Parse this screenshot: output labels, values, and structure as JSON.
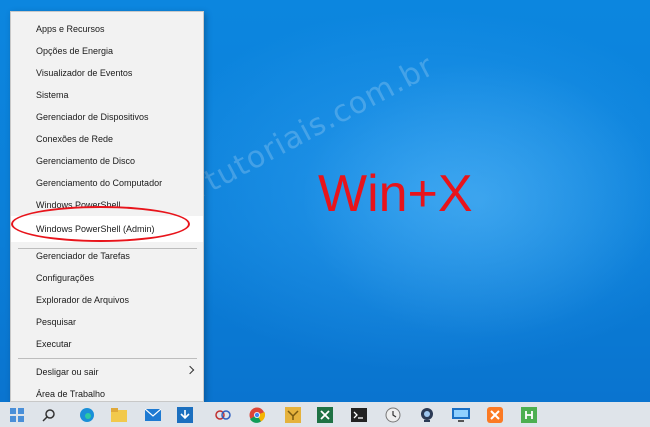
{
  "desktop": {
    "hotkey_label": "Win+X",
    "watermark_text": "supertutoriais.com.br",
    "accent_color": "#e8141b"
  },
  "menu": {
    "items": [
      "Apps e Recursos",
      "Opções de Energia",
      "Visualizador de Eventos",
      "Sistema",
      "Gerenciador de Dispositivos",
      "Conexões de Rede",
      "Gerenciamento de Disco",
      "Gerenciamento do Computador",
      "Windows PowerShell",
      "Windows PowerShell (Admin)",
      "Gerenciador de Tarefas",
      "Configurações",
      "Explorador de Arquivos",
      "Pesquisar",
      "Executar",
      "Desligar ou sair",
      "Área de Trabalho"
    ],
    "highlighted_item": "Windows PowerShell (Admin)"
  },
  "taskbar": {
    "icons": [
      "start-icon",
      "search-icon",
      "edge-icon",
      "file-explorer-icon",
      "mail-icon",
      "download-icon",
      "snipping-tool-icon",
      "chrome-icon",
      "folder-tool-icon",
      "excel-icon",
      "terminal-icon",
      "clock-icon",
      "webcam-icon",
      "remote-desktop-icon",
      "xampp-icon",
      "green-app-icon"
    ]
  }
}
